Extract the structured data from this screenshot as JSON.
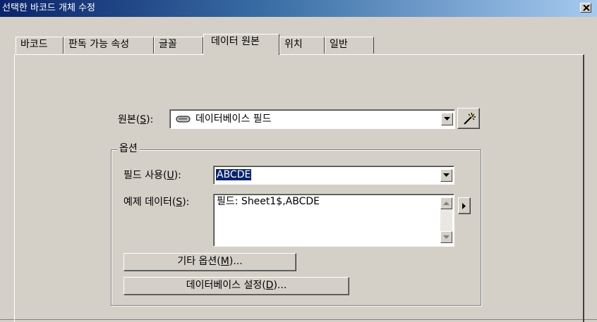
{
  "window": {
    "title": "선택한 바코드 개체 수정",
    "close_icon": "close-icon"
  },
  "tabs": [
    {
      "label": "바코드",
      "active": false
    },
    {
      "label": "판독 가능 속성",
      "active": false
    },
    {
      "label": "글꼴",
      "active": false
    },
    {
      "label": "데이터 원본",
      "active": true
    },
    {
      "label": "위치",
      "active": false
    },
    {
      "label": "일반",
      "active": false
    }
  ],
  "source": {
    "label_prefix": "원본(",
    "label_accel": "S",
    "label_suffix": "):",
    "icon": "database-icon",
    "value": "데이터베이스 필드",
    "wizard_icon": "wizard-wand-icon"
  },
  "options_group": {
    "title": "옵션",
    "field_use": {
      "label_prefix": "필드 사용(",
      "label_accel": "U",
      "label_suffix": "):",
      "value": "ABCDE"
    },
    "sample_data": {
      "label_prefix": "예제 데이터(",
      "label_accel": "S",
      "label_suffix": "):",
      "value": "필드: Sheet1$,ABCDE"
    },
    "other_options_button": {
      "prefix": "기타 옵션(",
      "accel": "M",
      "suffix": ")..."
    },
    "db_settings_button": {
      "prefix": "데이터베이스 설정(",
      "accel": "D",
      "suffix": ")..."
    }
  },
  "colors": {
    "titlebar_start": "#0a246a",
    "titlebar_end": "#a6caf0",
    "face": "#d4d0c8",
    "selection": "#0a246a"
  }
}
